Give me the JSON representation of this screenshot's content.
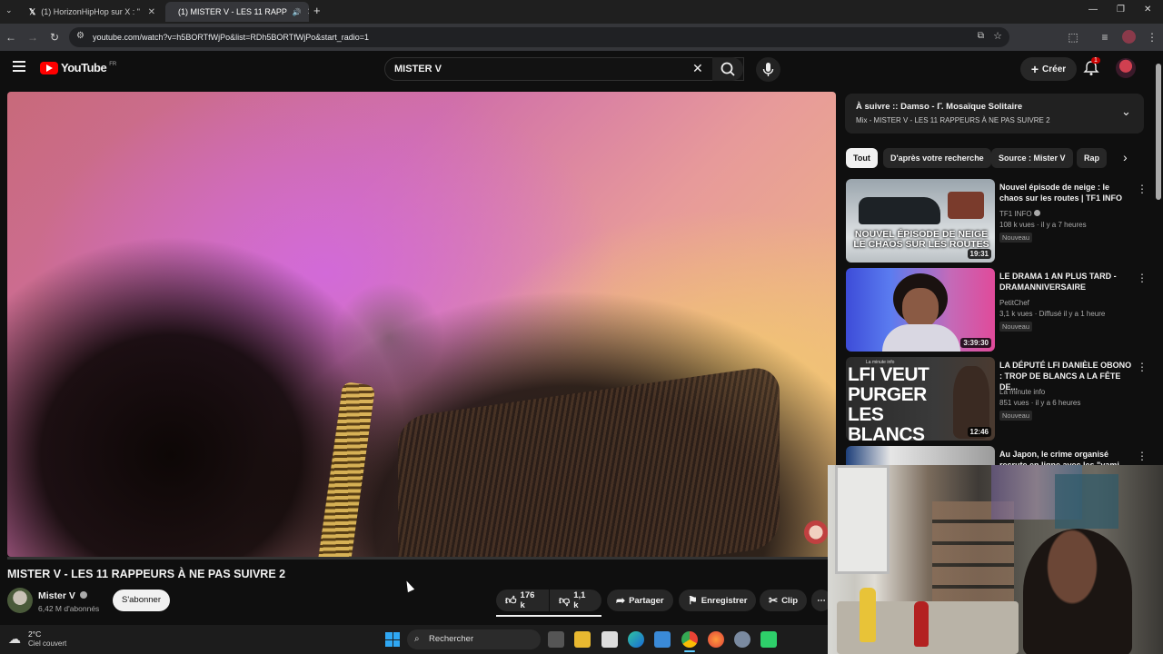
{
  "browser": {
    "tabs": [
      {
        "label": "(1) HorizonHipHop sur X : \"",
        "active": false
      },
      {
        "label": "(1) MISTER V - LES 11 RAPP",
        "active": true
      }
    ],
    "new_tab": "+",
    "url": "youtube.com/watch?v=h5BORTfWjPo&list=RDh5BORTfWjPo&start_radio=1"
  },
  "header": {
    "logo": "YouTube",
    "country": "FR",
    "search_value": "MISTER V",
    "create_label": "Créer",
    "notification_count": "1"
  },
  "video": {
    "title": "MISTER V - LES 11 RAPPEURS À NE PAS SUIVRE 2",
    "channel": "Mister V",
    "subscribers": "6,42 M d'abonnés",
    "subscribe_label": "S'abonner",
    "likes": "176 k",
    "dislikes": "1,1 k",
    "share_label": "Partager",
    "save_label": "Enregistrer",
    "clip_label": "Clip"
  },
  "sidebar": {
    "up_next_line1": "À suivre :: Damso - Γ. Mosaïque Solitaire",
    "up_next_line2": "Mix - MISTER V - LES 11 RAPPEURS À NE PAS SUIVRE 2",
    "chips": [
      "Tout",
      "D'après votre recherche",
      "Source : Mister V",
      "Rap"
    ],
    "recommendations": [
      {
        "title": "Nouvel épisode de neige : le chaos sur les routes | TF1 INFO",
        "channel": "TF1 INFO",
        "meta": "108 k vues · il y a 7 heures",
        "badge": "Nouveau",
        "duration": "19:31",
        "thumb_text": "NOUVEL ÉPISODE DE NEIGE LE CHAOS SUR LES ROUTES"
      },
      {
        "title": "LE DRAMA 1 AN PLUS TARD - DRAMANNIVERSAIRE",
        "channel": "PetitChef",
        "meta": "3,1 k vues · Diffusé il y a 1 heure",
        "badge": "Nouveau",
        "duration": "3:39:30",
        "thumb_text": ""
      },
      {
        "title": "LA DÉPUTÉ LFI DANIÈLE OBONO : TROP DE BLANCS A LA FÊTE DE...",
        "channel": "La minute info",
        "meta": "851 vues · il y a 6 heures",
        "badge": "Nouveau",
        "duration": "12:46",
        "thumb_text": "LFI VEUT PURGER LES BLANCS",
        "thumb_small": "La minute info"
      },
      {
        "title": "Au Japon, le crime organisé recrute en ligne avec les \"yami",
        "channel": "",
        "meta": "",
        "badge": "",
        "duration": "",
        "thumb_text": ""
      }
    ]
  },
  "taskbar": {
    "temperature": "2°C",
    "weather": "Ciel couvert",
    "search_label": "Rechercher"
  },
  "colors": {
    "background": "#0f0f0f",
    "youtube_red": "#ff0000",
    "chip_selected": "#f1f1f1",
    "chip": "#272727",
    "lfi_green": "#9be54a"
  }
}
